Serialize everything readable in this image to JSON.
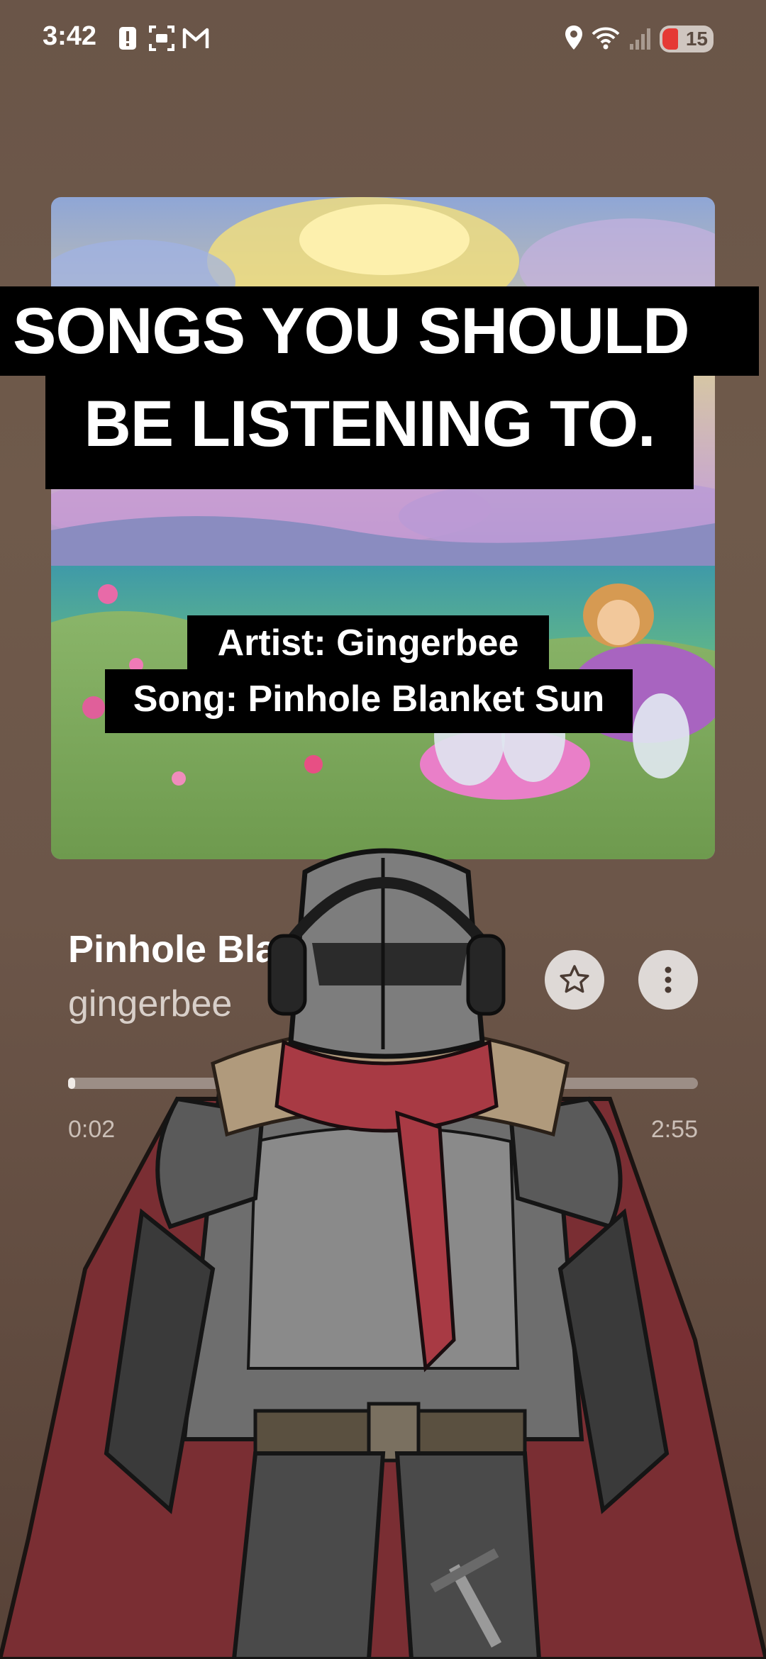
{
  "status_bar": {
    "time": "3:42",
    "battery_level": "15",
    "icons": [
      "alert-icon",
      "screenshot-icon",
      "gmail-icon",
      "location-icon",
      "wifi-icon",
      "signal-icon",
      "battery-icon"
    ]
  },
  "captions": {
    "line1": "SONGS YOU SHOULD",
    "line2": "BE LISTENING TO.",
    "artist_line": "Artist: Gingerbee",
    "song_line": "Song: Pinhole Blanket Sun"
  },
  "player": {
    "track_title": "Pinhole Bla",
    "artist": "gingerbee",
    "elapsed": "0:02",
    "total": "2:55",
    "progress_fraction": 0.011,
    "favorite_icon": "star-icon",
    "more_icon": "more-vertical-icon"
  },
  "colors": {
    "background": "#6a5548",
    "caption_bg": "#000000",
    "progress_fill": "#f0ebe7",
    "battery_low": "#e53935"
  }
}
